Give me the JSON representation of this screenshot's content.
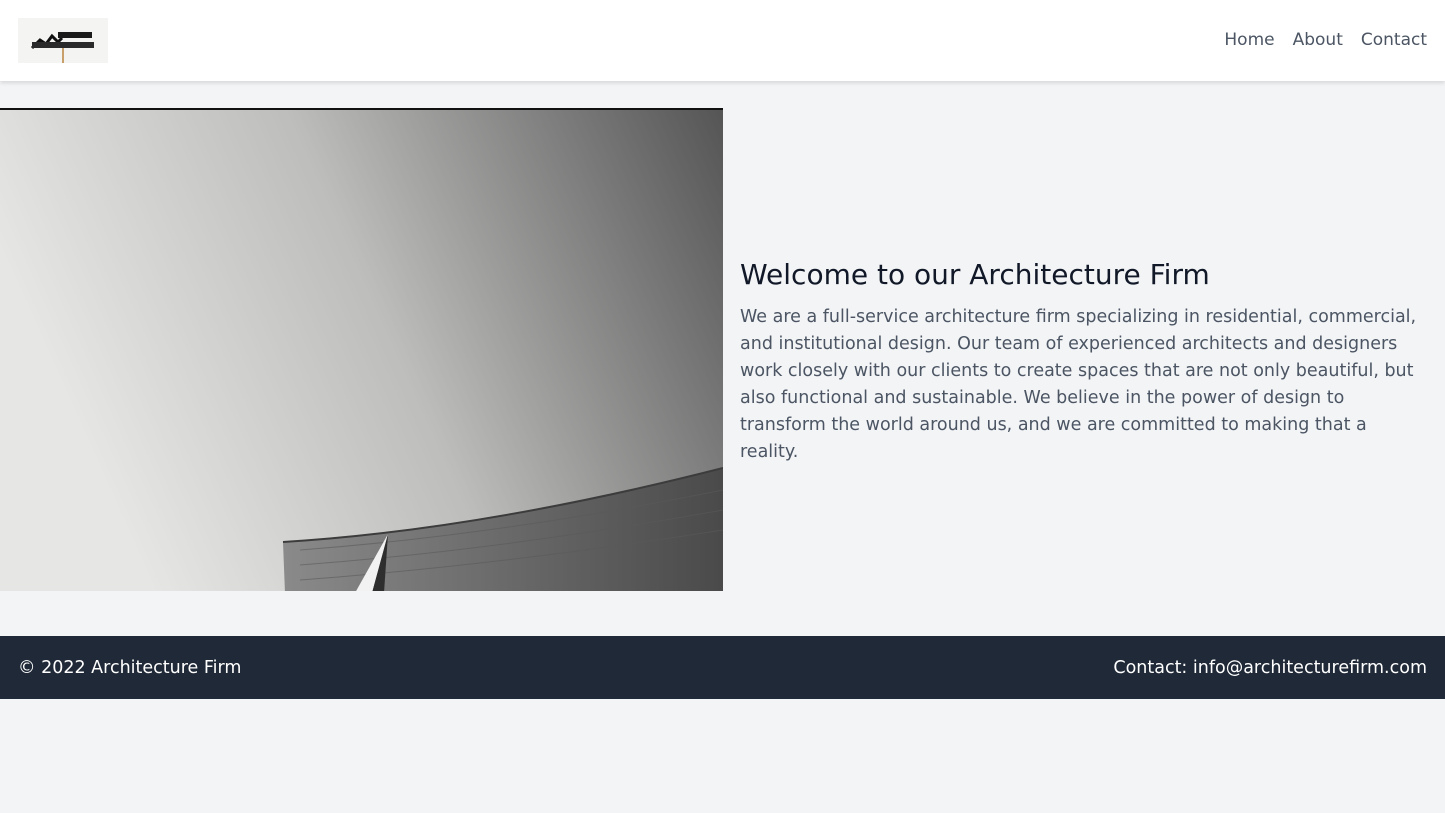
{
  "header": {
    "logo_icon": "happy-halloween-logo",
    "nav": [
      {
        "label": "Home"
      },
      {
        "label": "About"
      },
      {
        "label": "Contact"
      }
    ]
  },
  "hero": {
    "image_icon": "architecture-photo",
    "title": "Welcome to our Architecture Firm",
    "body": "We are a full-service architecture firm specializing in residential, commercial, and institutional design. Our team of experienced architects and designers work closely with our clients to create spaces that are not only beautiful, but also functional and sustainable. We believe in the power of design to transform the world around us, and we are committed to making that a reality."
  },
  "footer": {
    "copyright": "© 2022 Architecture Firm",
    "contact": "Contact: info@architecturefirm.com"
  },
  "colors": {
    "page_bg": "#f3f4f6",
    "header_bg": "#ffffff",
    "footer_bg": "#1f2937",
    "nav_text": "#4b5563",
    "title_text": "#111827"
  }
}
